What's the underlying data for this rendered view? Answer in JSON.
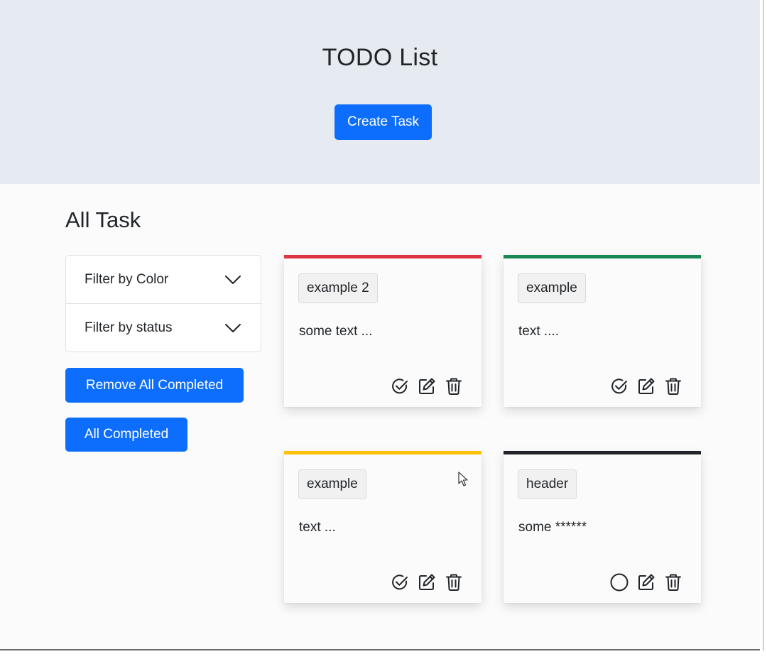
{
  "header": {
    "title": "TODO List",
    "create_button": "Create Task"
  },
  "main": {
    "section_title": "All Task",
    "filters": [
      {
        "label": "Filter by Color",
        "icon": "chevron-down-icon"
      },
      {
        "label": "Filter by status",
        "icon": "chevron-down-icon"
      }
    ],
    "remove_all_completed": "Remove All Completed",
    "all_completed": "All Completed"
  },
  "tasks": [
    {
      "title": "example 2",
      "text": "some text ...",
      "color": "#dc3545",
      "completed": true
    },
    {
      "title": "example",
      "text": "text ....",
      "color": "#198754",
      "completed": true
    },
    {
      "title": "example",
      "text": "text ...",
      "color": "#ffc107",
      "completed": true
    },
    {
      "title": "header",
      "text": "some ******",
      "color": "#212529",
      "completed": false
    }
  ],
  "colors": {
    "primary": "#0d6efd",
    "hero_background": "#e6eaf1"
  }
}
